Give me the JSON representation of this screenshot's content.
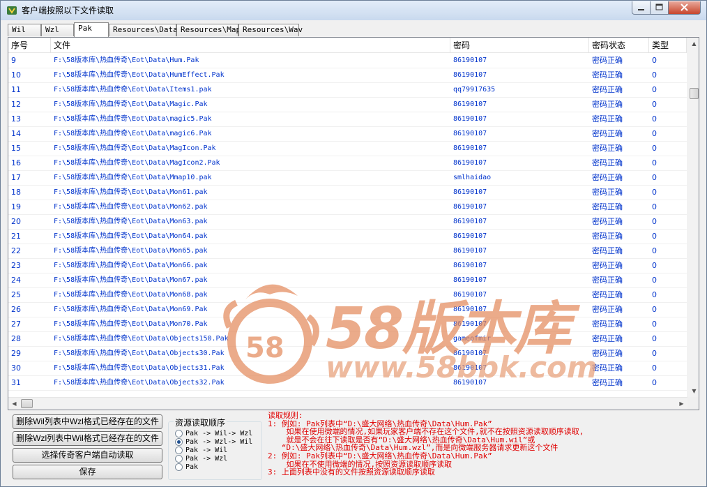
{
  "window": {
    "title": "客户端按照以下文件读取"
  },
  "tabs": [
    "Wil",
    "Wzl",
    "Pak",
    "Resources\\Data",
    "Resources\\Map",
    "Resources\\Wav"
  ],
  "active_tab": "Pak",
  "list": {
    "columns": [
      "序号",
      "文件",
      "密码",
      "密码状态",
      "类型"
    ],
    "rows": [
      [
        "9",
        "F:\\58版本库\\热血传奇\\Eot\\Data\\Hum.Pak",
        "86190107",
        "密码正确",
        "0"
      ],
      [
        "10",
        "F:\\58版本库\\热血传奇\\Eot\\Data\\HumEffect.Pak",
        "86190107",
        "密码正确",
        "0"
      ],
      [
        "11",
        "F:\\58版本库\\热血传奇\\Eot\\Data\\Items1.pak",
        "qq79917635",
        "密码正确",
        "0"
      ],
      [
        "12",
        "F:\\58版本库\\热血传奇\\Eot\\Data\\Magic.Pak",
        "86190107",
        "密码正确",
        "0"
      ],
      [
        "13",
        "F:\\58版本库\\热血传奇\\Eot\\Data\\magic5.Pak",
        "86190107",
        "密码正确",
        "0"
      ],
      [
        "14",
        "F:\\58版本库\\热血传奇\\Eot\\Data\\magic6.Pak",
        "86190107",
        "密码正确",
        "0"
      ],
      [
        "15",
        "F:\\58版本库\\热血传奇\\Eot\\Data\\MagIcon.Pak",
        "86190107",
        "密码正确",
        "0"
      ],
      [
        "16",
        "F:\\58版本库\\热血传奇\\Eot\\Data\\MagIcon2.Pak",
        "86190107",
        "密码正确",
        "0"
      ],
      [
        "17",
        "F:\\58版本库\\热血传奇\\Eot\\Data\\Mmap10.pak",
        "smlhaidao",
        "密码正确",
        "0"
      ],
      [
        "18",
        "F:\\58版本库\\热血传奇\\Eot\\Data\\Mon61.pak",
        "86190107",
        "密码正确",
        "0"
      ],
      [
        "19",
        "F:\\58版本库\\热血传奇\\Eot\\Data\\Mon62.pak",
        "86190107",
        "密码正确",
        "0"
      ],
      [
        "20",
        "F:\\58版本库\\热血传奇\\Eot\\Data\\Mon63.pak",
        "86190107",
        "密码正确",
        "0"
      ],
      [
        "21",
        "F:\\58版本库\\热血传奇\\Eot\\Data\\Mon64.pak",
        "86190107",
        "密码正确",
        "0"
      ],
      [
        "22",
        "F:\\58版本库\\热血传奇\\Eot\\Data\\Mon65.pak",
        "86190107",
        "密码正确",
        "0"
      ],
      [
        "23",
        "F:\\58版本库\\热血传奇\\Eot\\Data\\Mon66.pak",
        "86190107",
        "密码正确",
        "0"
      ],
      [
        "24",
        "F:\\58版本库\\热血传奇\\Eot\\Data\\Mon67.pak",
        "86190107",
        "密码正确",
        "0"
      ],
      [
        "25",
        "F:\\58版本库\\热血传奇\\Eot\\Data\\Mon68.pak",
        "86190107",
        "密码正确",
        "0"
      ],
      [
        "26",
        "F:\\58版本库\\热血传奇\\Eot\\Data\\Mon69.Pak",
        "86190107",
        "密码正确",
        "0"
      ],
      [
        "27",
        "F:\\58版本库\\热血传奇\\Eot\\Data\\Mon70.Pak",
        "86190107",
        "密码正确",
        "0"
      ],
      [
        "28",
        "F:\\58版本库\\热血传奇\\Eot\\Data\\Objects150.Pak",
        "gameofmir",
        "密码正确",
        "0"
      ],
      [
        "29",
        "F:\\58版本库\\热血传奇\\Eot\\Data\\Objects30.Pak",
        "86190107",
        "密码正确",
        "0"
      ],
      [
        "30",
        "F:\\58版本库\\热血传奇\\Eot\\Data\\Objects31.Pak",
        "86190107",
        "密码正确",
        "0"
      ],
      [
        "31",
        "F:\\58版本库\\热血传奇\\Eot\\Data\\Objects32.Pak",
        "86190107",
        "密码正确",
        "0"
      ]
    ]
  },
  "buttons": {
    "delete_wil": "删除Wil列表中Wzl格式已经存在的文件",
    "delete_wzl": "删除Wzl列表中Wil格式已经存在的文件",
    "auto_read": "选择传奇客户端自动读取",
    "save": "保存"
  },
  "load_order": {
    "title": "资源读取顺序",
    "options": [
      "Pak -> Wil-> Wzl",
      "Pak -> Wzl-> Wil",
      "Pak -> Wil",
      "Pak -> Wzl",
      "Pak"
    ],
    "selected_index": 1
  },
  "rules": [
    "读取规则:",
    "1: 例如: Pak列表中“D:\\盛大网络\\热血传奇\\Data\\Hum.Pak”",
    "    如果在使用微端的情况,如果玩家客户端不存在这个文件,就不在按照资源读取顺序读取,",
    "    就是不会在往下读取是否有“D:\\盛大网络\\热血传奇\\Data\\Hum.wil”或",
    "   “D:\\盛大网络\\热血传奇\\Data\\Hum.wzl”,而是向微端服务器请求更新这个文件",
    "2: 例如: Pak列表中“D:\\盛大网络\\热血传奇\\Data\\Hum.Pak”",
    "    如果在不使用微端的情况,按照资源读取顺序读取",
    "3: 上面列表中没有的文件按照资源读取顺序读取"
  ],
  "watermark": {
    "brand": "58版本库",
    "url": "www.58bbk.com",
    "badge": "58"
  },
  "colors": {
    "row_text": "#0033cc",
    "rules_text": "#e00000",
    "watermark": "#e48b5e"
  }
}
